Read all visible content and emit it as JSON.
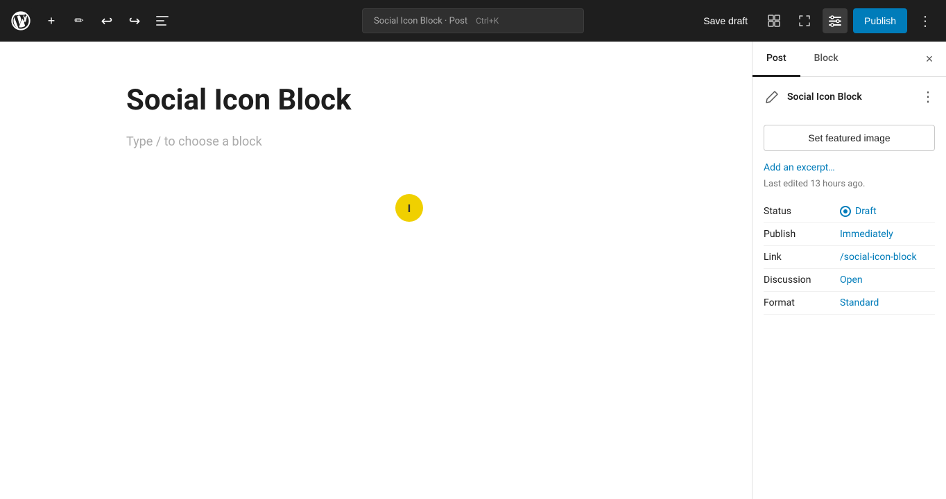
{
  "toolbar": {
    "wp_logo_title": "WordPress",
    "add_button_label": "+",
    "edit_tool_label": "✏",
    "undo_label": "↩",
    "redo_label": "↪",
    "tools_label": "≡",
    "search_text": "Social Icon Block · Post",
    "search_shortcut": "Ctrl+K",
    "save_draft_label": "Save draft",
    "view_options_title": "View options",
    "fullscreen_title": "Fullscreen",
    "settings_title": "Settings",
    "publish_label": "Publish",
    "more_tools_label": "⋮"
  },
  "editor": {
    "post_title": "Social Icon Block",
    "placeholder": "Type / to choose a block",
    "cursor_symbol": "I"
  },
  "sidebar": {
    "tab_post_label": "Post",
    "tab_block_label": "Block",
    "close_label": "×",
    "active_tab": "Post",
    "block_section": {
      "icon_symbol": "✏",
      "title": "Social Icon Block",
      "more_label": "⋮"
    },
    "set_featured_label": "Set featured image",
    "add_excerpt_label": "Add an excerpt…",
    "last_edited": "Last edited 13 hours ago.",
    "meta": [
      {
        "label": "Status",
        "value": "Draft",
        "type": "link",
        "has_circle": true
      },
      {
        "label": "Publish",
        "value": "Immediately",
        "type": "link"
      },
      {
        "label": "Link",
        "value": "/social-icon-block",
        "type": "link"
      },
      {
        "label": "Discussion",
        "value": "Open",
        "type": "link"
      },
      {
        "label": "Format",
        "value": "Standard",
        "type": "link"
      }
    ]
  }
}
